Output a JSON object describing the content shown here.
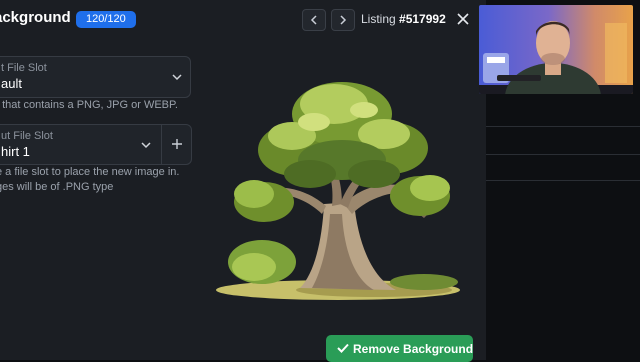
{
  "modal": {
    "title": "ackground",
    "counter": "120/120",
    "listing_label": "Listing",
    "listing_number": "#517992",
    "source_slot": {
      "label": "t File Slot",
      "value": "ault",
      "help": "t that contains a PNG, JPG or WEBP."
    },
    "output_slot": {
      "label": "ut File Slot",
      "value": "hirt 1",
      "help_line1": "e a file slot to place the new image in.",
      "help_line2": "ges will be of .PNG type"
    },
    "action_label": "Remove Background"
  },
  "colors": {
    "accent_blue": "#1f6feb",
    "success_green": "#2a9d57",
    "modal_bg": "#1b1e23"
  },
  "icons": [
    "chevron-left-icon",
    "chevron-right-icon",
    "close-icon",
    "chevron-down-icon",
    "plus-icon",
    "check-icon"
  ]
}
